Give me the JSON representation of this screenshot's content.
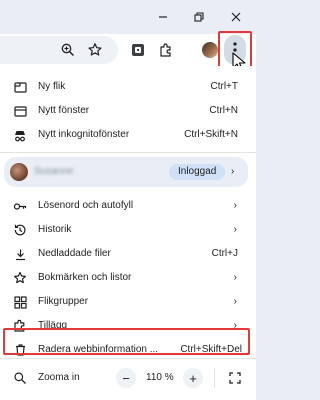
{
  "icons": {
    "minimize": "minimize-icon",
    "restore": "restore-icon",
    "close": "close-icon",
    "zoom_lens": "zoom-icon",
    "bookmark_star": "star-icon",
    "more": "three-dot-menu-icon"
  },
  "accent_color": "#e5383b",
  "menu": {
    "new_tab": {
      "label": "Ny flik",
      "shortcut": "Ctrl+T"
    },
    "new_window": {
      "label": "Nytt fönster",
      "shortcut": "Ctrl+N"
    },
    "incognito": {
      "label": "Nytt inkognitofönster",
      "shortcut": "Ctrl+Skift+N"
    },
    "profile": {
      "name": "Susanne",
      "status": "Inloggad"
    },
    "passwords": {
      "label": "Lösenord och autofyll"
    },
    "history": {
      "label": "Historik"
    },
    "downloads": {
      "label": "Nedladdade filer",
      "shortcut": "Ctrl+J"
    },
    "bookmarks": {
      "label": "Bokmärken och listor"
    },
    "tab_groups": {
      "label": "Flikgrupper"
    },
    "extensions": {
      "label": "Tillägg"
    },
    "clear_data": {
      "label": "Radera webbinformation ...",
      "shortcut": "Ctrl+Skift+Del"
    },
    "zoom": {
      "label": "Zooma in",
      "value": "110 %",
      "minus": "−",
      "plus": "+"
    }
  }
}
